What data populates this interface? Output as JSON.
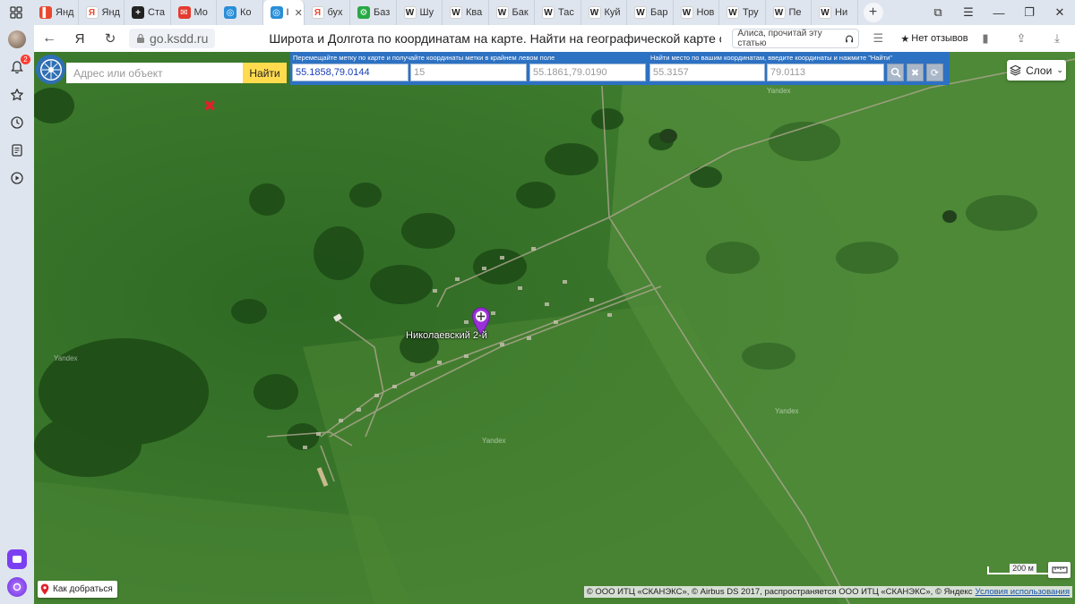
{
  "tabs": [
    {
      "label": "Янд",
      "icon_color": "#e8492e",
      "glyph": "▌"
    },
    {
      "label": "Янд",
      "icon_color": "#ffffff",
      "glyph": "Я"
    },
    {
      "label": "Ста",
      "icon_color": "#222222",
      "glyph": "+"
    },
    {
      "label": "Мо",
      "icon_color": "#e33b2e",
      "glyph": "✉"
    },
    {
      "label": "Ко",
      "icon_color": "#2a8fd8",
      "glyph": "◎"
    },
    {
      "label": "I",
      "icon_color": "#2a8fd8",
      "glyph": "◎",
      "active": true
    },
    {
      "label": "бух",
      "icon_color": "#ffffff",
      "glyph": "Я"
    },
    {
      "label": "Баз",
      "icon_color": "#27a844",
      "glyph": "⚙"
    },
    {
      "label": "Шу",
      "icon_color": "#ffffff",
      "glyph": "W"
    },
    {
      "label": "Ква",
      "icon_color": "#ffffff",
      "glyph": "W"
    },
    {
      "label": "Бак",
      "icon_color": "#ffffff",
      "glyph": "W"
    },
    {
      "label": "Тас",
      "icon_color": "#ffffff",
      "glyph": "W"
    },
    {
      "label": "Куй",
      "icon_color": "#ffffff",
      "glyph": "W"
    },
    {
      "label": "Бар",
      "icon_color": "#ffffff",
      "glyph": "W"
    },
    {
      "label": "Нов",
      "icon_color": "#ffffff",
      "glyph": "W"
    },
    {
      "label": "Тру",
      "icon_color": "#ffffff",
      "glyph": "W"
    },
    {
      "label": "Пе",
      "icon_color": "#ffffff",
      "glyph": "W"
    },
    {
      "label": "Ни",
      "icon_color": "#ffffff",
      "glyph": "W"
    }
  ],
  "tab_close": "✕",
  "new_tab": "+",
  "address": {
    "domain": "go.ksdd.ru",
    "title": "Широта и Долгота по координатам на карте. Найти на географической карте онлайн",
    "alice_hint": "Алиса, прочитай эту статью",
    "reviews": "Нет отзывов",
    "reviews_star": "★"
  },
  "sidebar": {
    "notifications_badge": "2"
  },
  "map": {
    "search_placeholder": "Адрес или объект",
    "search_button": "Найти",
    "panel": {
      "caption_left": "Перемещайте метку по карте и получайте координаты метки в крайнем левом поле",
      "caption_right": "Найти место по вашим координатам, введите координаты и нажмите \"Найти\"",
      "coords_value": "55.1858,79.0144",
      "zoom_value": "15",
      "center_value": "55.1861,79.0190",
      "lat_value": "55.3157",
      "lon_value": "79.0113"
    },
    "layers_button": "Слои",
    "place_label": "Николаевский 2-й",
    "watermarks": [
      "Yandex",
      "Yandex",
      "Yandex",
      "Yandex"
    ],
    "route_button": "Как добраться",
    "scale_label": "200 м",
    "copyright": "© ООО ИТЦ «СКАНЭКС», © Airbus DS 2017, распространяется ООО ИТЦ «СКАНЭКС», © Яндекс",
    "terms_link": "Условия использования"
  },
  "colors": {
    "panel_blue": "#2d71c2",
    "search_yellow": "#ffdb4d",
    "marker_purple": "#9b30d9",
    "red_cross": "#e0202a"
  }
}
